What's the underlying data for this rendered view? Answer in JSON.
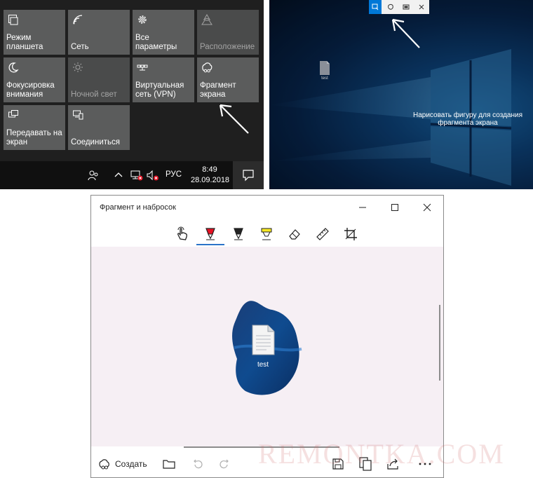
{
  "action_center": {
    "tiles": [
      {
        "label": "Режим планшета",
        "icon": "tablet-mode-icon",
        "enabled": true
      },
      {
        "label": "Сеть",
        "icon": "network-icon",
        "enabled": true
      },
      {
        "label": "Все параметры",
        "icon": "gear-icon",
        "enabled": true
      },
      {
        "label": "Расположение",
        "icon": "location-icon",
        "enabled": false
      },
      {
        "label": "Фокусировка внимания",
        "icon": "moon-icon",
        "enabled": true
      },
      {
        "label": "Ночной свет",
        "icon": "brightness-icon",
        "enabled": false
      },
      {
        "label": "Виртуальная сеть (VPN)",
        "icon": "vpn-icon",
        "enabled": true
      },
      {
        "label": "Фрагмент экрана",
        "icon": "screen-snip-icon",
        "enabled": true
      },
      {
        "label": "Передавать на экран",
        "icon": "project-icon",
        "enabled": true
      },
      {
        "label": "Соединиться",
        "icon": "connect-icon",
        "enabled": true
      }
    ]
  },
  "taskbar": {
    "language": "РУС",
    "time": "8:49",
    "date": "28.09.2018",
    "icons": [
      "people-icon",
      "chevron-up-icon",
      "network-disconnected-icon",
      "volume-muted-icon",
      "notifications-icon"
    ]
  },
  "desktop": {
    "hint": "Нарисовать фигуру для создания фрагмента экрана",
    "file_label": "test",
    "snip_modes": [
      "rectangular-snip-icon",
      "freeform-snip-icon",
      "window-snip-icon",
      "close-icon"
    ]
  },
  "snip_window": {
    "title": "Фрагмент и набросок",
    "tools": [
      "touch-writing-icon",
      "ballpoint-pen-icon",
      "pencil-icon",
      "highlighter-icon",
      "eraser-icon",
      "ruler-icon",
      "crop-icon"
    ],
    "selected_tool_index": 1,
    "canvas_file_label": "test",
    "create_label": "Создать"
  },
  "watermark": "REMONTKA.COM",
  "colors": {
    "tile": "#5b5c5c",
    "accent": "#2b73c8",
    "canvas": "#f6eff4",
    "pen_red": "#e81123",
    "highlighter_yellow": "#f7e823"
  }
}
